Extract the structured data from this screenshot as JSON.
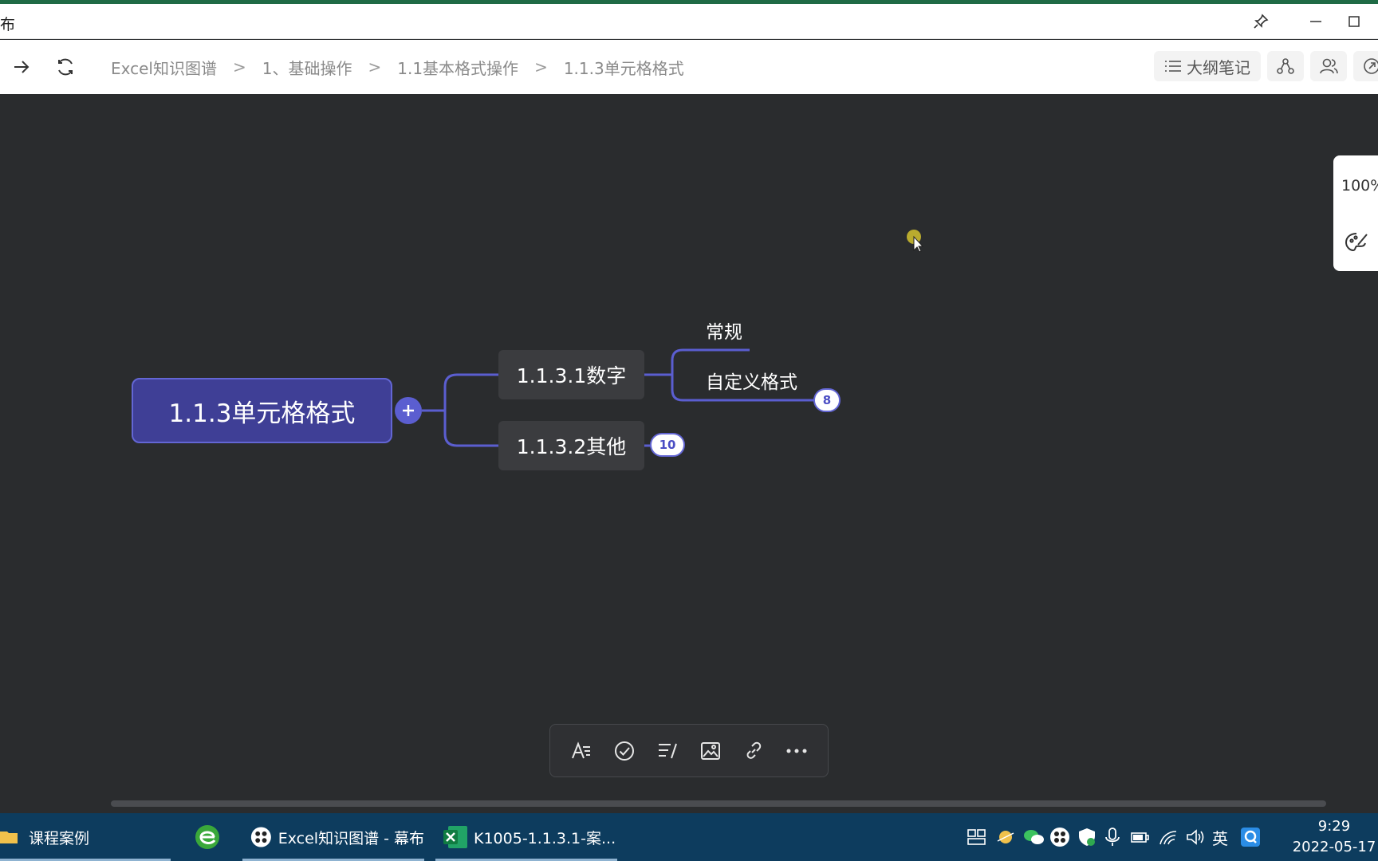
{
  "window": {
    "title_fragment": "布"
  },
  "breadcrumb": {
    "items": [
      "Excel知识图谱",
      "1、基础操作",
      "1.1基本格式操作",
      "1.1.3单元格格式"
    ],
    "separator": ">"
  },
  "header": {
    "outline_label": "大纲笔记"
  },
  "zoom": {
    "level": "100%"
  },
  "mindmap": {
    "root": "1.1.3单元格格式",
    "children": [
      {
        "label": "1.1.3.1数字",
        "children": [
          "常规",
          "自定义格式"
        ],
        "leaf_badge": "8"
      },
      {
        "label": "1.1.3.2其他",
        "badge": "10"
      }
    ]
  },
  "taskbar": {
    "items": [
      {
        "label": "课程案例"
      },
      {
        "label": "Excel知识图谱 - 幕布"
      },
      {
        "label": "K1005-1.1.3.1-案..."
      }
    ],
    "ime": "英",
    "time": "9:29",
    "date": "2022-05-17"
  },
  "colors": {
    "accent": "#5b5ed0",
    "root_fill": "#3f3f96",
    "canvas": "#2a2c2e",
    "taskbar": "#0d3c5e"
  }
}
